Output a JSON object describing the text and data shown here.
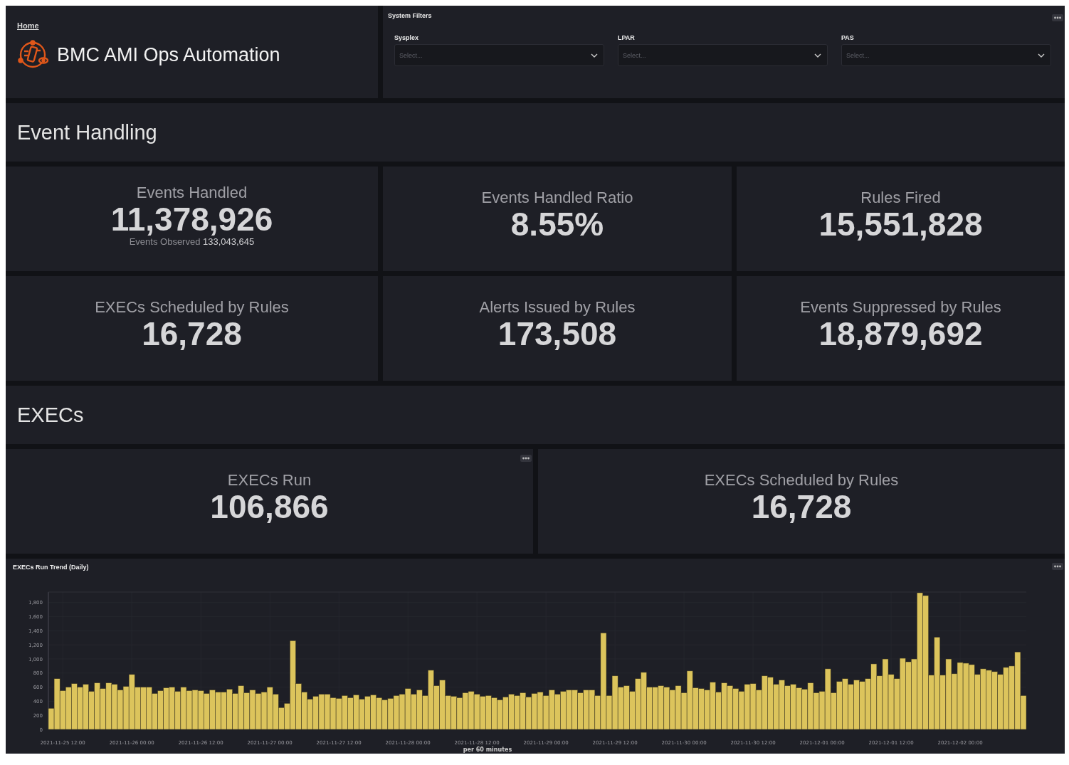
{
  "header": {
    "breadcrumb": "Home",
    "title": "BMC AMI Ops Automation"
  },
  "system_filters": {
    "title": "System Filters",
    "menu_button": true,
    "filters": [
      {
        "label": "Sysplex",
        "placeholder": "Select..."
      },
      {
        "label": "LPAR",
        "placeholder": "Select..."
      },
      {
        "label": "PAS",
        "placeholder": "Select..."
      }
    ]
  },
  "sections": [
    {
      "title": "Event Handling",
      "stats": [
        {
          "title": "Events Handled",
          "value": "11,378,926",
          "note": "Events Observed **133,043,645**",
          "menu_button": false
        },
        {
          "title": "Events Handled Ratio",
          "value": "8.55%",
          "menu_button": false
        },
        {
          "title": "Rules Fired",
          "value": "15,551,828",
          "menu_button": false
        },
        {
          "title": "EXECs Scheduled by Rules",
          "value": "16,728",
          "menu_button": false
        },
        {
          "title": "Alerts Issued by Rules",
          "value": "173,508",
          "menu_button": false
        },
        {
          "title": "Events Suppressed by Rules",
          "value": "18,879,692",
          "menu_button": false
        }
      ]
    },
    {
      "title": "EXECs",
      "stats": [
        {
          "title": "EXECs Run",
          "value": "106,866",
          "menu_button": true
        },
        {
          "title": "EXECs Scheduled by Rules",
          "value": "16,728",
          "menu_button": false
        }
      ]
    }
  ],
  "chart_panel": {
    "title": "EXECs Run Trend (Daily)",
    "menu_button": true,
    "chart_data": {
      "type": "bar",
      "xlabel": "per 60 minutes",
      "ylim": [
        0,
        1950
      ],
      "grid": true,
      "categories": [
        null,
        null,
        "2021-11-25 12:00",
        null,
        null,
        null,
        null,
        null,
        null,
        null,
        null,
        null,
        null,
        null,
        "2021-11-26 00:00",
        null,
        null,
        null,
        null,
        null,
        null,
        null,
        null,
        null,
        null,
        null,
        "2021-11-26 12:00",
        null,
        null,
        null,
        null,
        null,
        null,
        null,
        null,
        null,
        null,
        null,
        "2021-11-27 00:00",
        null,
        null,
        null,
        null,
        null,
        null,
        null,
        null,
        null,
        null,
        null,
        "2021-11-27 12:00",
        null,
        null,
        null,
        null,
        null,
        null,
        null,
        null,
        null,
        null,
        null,
        "2021-11-28 00:00",
        null,
        null,
        null,
        null,
        null,
        null,
        null,
        null,
        null,
        null,
        null,
        "2021-11-28 12:00",
        null,
        null,
        null,
        null,
        null,
        null,
        null,
        null,
        null,
        null,
        null,
        "2021-11-29 00:00",
        null,
        null,
        null,
        null,
        null,
        null,
        null,
        null,
        null,
        null,
        null,
        "2021-11-29 12:00",
        null,
        null,
        null,
        null,
        null,
        null,
        null,
        null,
        null,
        null,
        null,
        "2021-11-30 00:00",
        null,
        null,
        null,
        null,
        null,
        null,
        null,
        null,
        null,
        null,
        null,
        "2021-11-30 12:00",
        null,
        null,
        null,
        null,
        null,
        null,
        null,
        null,
        null,
        null,
        null,
        "2021-12-01 00:00",
        null,
        null,
        null,
        null,
        null,
        null,
        null,
        null,
        null,
        null,
        null,
        "2021-12-01 12:00",
        null,
        null,
        null,
        null,
        null,
        null,
        null,
        null,
        null,
        null,
        null,
        "2021-12-02 00:00",
        null,
        null,
        null,
        null,
        null,
        null,
        null,
        null,
        null,
        null,
        null
      ],
      "yticks": [
        {
          "value": 0,
          "label": "0"
        },
        {
          "value": 200,
          "label": "200"
        },
        {
          "value": 400,
          "label": "400"
        },
        {
          "value": 600,
          "label": "600"
        },
        {
          "value": 800,
          "label": "800"
        },
        {
          "value": 1000,
          "label": "1,000"
        },
        {
          "value": 1200,
          "label": "1,200"
        },
        {
          "value": 1400,
          "label": "1,400"
        },
        {
          "value": 1600,
          "label": "1,600"
        },
        {
          "value": 1800,
          "label": "1,800"
        }
      ],
      "series": [
        {
          "color": "#dcc45c",
          "values": [
            300,
            720,
            550,
            600,
            650,
            600,
            640,
            540,
            660,
            580,
            660,
            640,
            560,
            610,
            780,
            600,
            600,
            600,
            510,
            550,
            590,
            600,
            540,
            600,
            550,
            560,
            550,
            510,
            560,
            530,
            530,
            570,
            510,
            620,
            520,
            560,
            510,
            530,
            600,
            500,
            310,
            370,
            1260,
            650,
            530,
            430,
            470,
            500,
            500,
            450,
            440,
            480,
            450,
            490,
            430,
            470,
            490,
            450,
            420,
            440,
            480,
            500,
            580,
            500,
            560,
            480,
            840,
            620,
            700,
            480,
            470,
            450,
            520,
            540,
            500,
            470,
            480,
            450,
            420,
            460,
            500,
            480,
            520,
            460,
            510,
            530,
            480,
            560,
            500,
            540,
            560,
            560,
            520,
            560,
            560,
            480,
            1370,
            480,
            760,
            600,
            620,
            540,
            720,
            810,
            600,
            600,
            620,
            600,
            560,
            620,
            520,
            830,
            590,
            580,
            560,
            670,
            530,
            660,
            620,
            580,
            540,
            640,
            650,
            560,
            760,
            740,
            640,
            700,
            620,
            640,
            590,
            570,
            660,
            520,
            540,
            860,
            520,
            680,
            720,
            640,
            700,
            680,
            720,
            930,
            760,
            1000,
            780,
            720,
            1010,
            960,
            1000,
            1940,
            1900,
            770,
            1310,
            770,
            1000,
            790,
            950,
            940,
            920,
            780,
            860,
            840,
            820,
            780,
            880,
            900,
            1100,
            480
          ]
        }
      ]
    }
  }
}
